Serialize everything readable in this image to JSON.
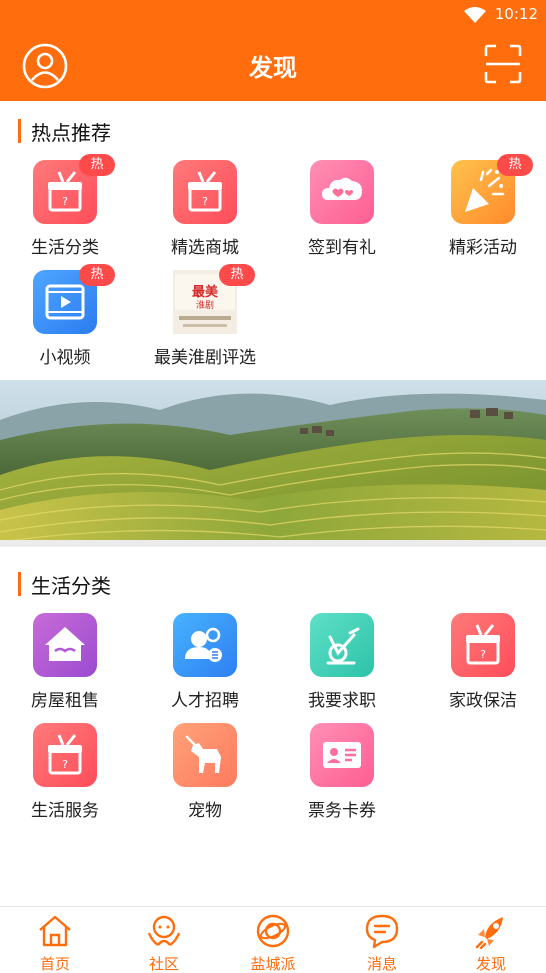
{
  "status_bar": {
    "time": "10:12"
  },
  "header": {
    "title": "发现"
  },
  "hot": {
    "title": "热点推荐",
    "badge": "热",
    "items": [
      {
        "label": "生活分类",
        "icon": "gift-box-icon",
        "hot": true
      },
      {
        "label": "精选商城",
        "icon": "gift-box-icon",
        "hot": false
      },
      {
        "label": "签到有礼",
        "icon": "cloud-hearts-icon",
        "hot": false
      },
      {
        "label": "精彩活动",
        "icon": "party-popper-icon",
        "hot": true
      },
      {
        "label": "小视频",
        "icon": "video-film-icon",
        "hot": true
      },
      {
        "label": "最美淮剧评选",
        "icon": "poster-thumbnail",
        "hot": true,
        "thumb_text": "最美 淮剧"
      }
    ]
  },
  "life": {
    "title": "生活分类",
    "items": [
      {
        "label": "房屋租售",
        "icon": "house-handshake-icon"
      },
      {
        "label": "人才招聘",
        "icon": "people-icon"
      },
      {
        "label": "我要求职",
        "icon": "exercise-bike-icon"
      },
      {
        "label": "家政保洁",
        "icon": "gift-box-icon"
      },
      {
        "label": "生活服务",
        "icon": "gift-box-icon"
      },
      {
        "label": "宠物",
        "icon": "dog-icon"
      },
      {
        "label": "票务卡券",
        "icon": "id-card-icon"
      }
    ]
  },
  "nav": {
    "items": [
      {
        "label": "首页",
        "icon": "home-icon"
      },
      {
        "label": "社区",
        "icon": "community-icon"
      },
      {
        "label": "盐城派",
        "icon": "planet-icon"
      },
      {
        "label": "消息",
        "icon": "chat-bubble-icon"
      },
      {
        "label": "发现",
        "icon": "rocket-icon",
        "active": true
      }
    ]
  },
  "colors": {
    "brand": "#ff6d0c",
    "badge": "#ff4a4a",
    "nav_label": "#ff6d0c"
  }
}
